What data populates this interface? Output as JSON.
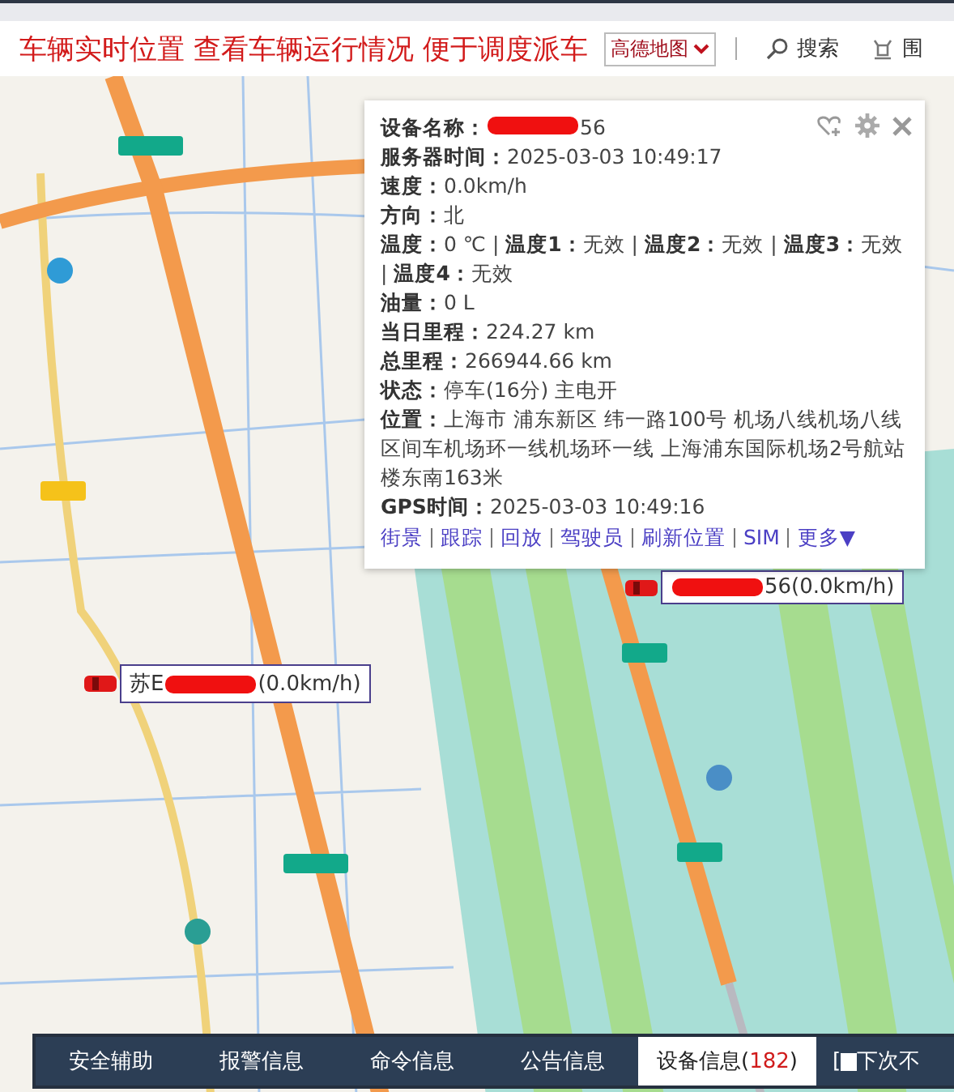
{
  "header": {
    "title": "车辆实时位置 查看车辆运行情况 便于调度派车",
    "map_select": "高德地图",
    "search": "搜索",
    "tool": "围"
  },
  "popup": {
    "device_label": "设备名称：",
    "device_suffix": "56",
    "rows": [
      "**服务器时间：**2025-03-03 10:49:17",
      "**速度：**0.0km/h",
      "**方向：**北",
      "**温度：**0 ℃ | **温度1：**无效 | **温度2：**无效 | **温度3：**无效 | **温度4：**无效",
      "**油量：**0 L",
      "**当日里程：**224.27 km",
      "**总里程：**266944.66 km",
      "**状态：**停车(16分) 主电开",
      "**位置：**上海市 浦东新区 纬一路100号 机场八线机场八线区间车机场环一线机场环一线 上海浦东国际机场2号航站楼东南163米",
      "**GPS时间：**2025-03-03 10:49:16"
    ],
    "links": [
      "街景",
      "跟踪",
      "回放",
      "驾驶员",
      "刷新位置",
      "SIM",
      "更多▼"
    ]
  },
  "vehicles": [
    {
      "suffix": "56(0.0km/h)"
    },
    {
      "prefix": "苏E",
      "suffix": "(0.0km/h)"
    }
  ],
  "tabs": [
    {
      "label": "安全辅助",
      "selected": false
    },
    {
      "label": "报警信息",
      "selected": false
    },
    {
      "label": "命令信息",
      "selected": false
    },
    {
      "label": "公告信息",
      "selected": false
    },
    {
      "label": "设备信息",
      "count": {
        "open": "(",
        "value": "182",
        "close": ")"
      },
      "selected": true
    }
  ],
  "option": {
    "bracket": "[",
    "label": "下次不",
    "checked": false
  }
}
